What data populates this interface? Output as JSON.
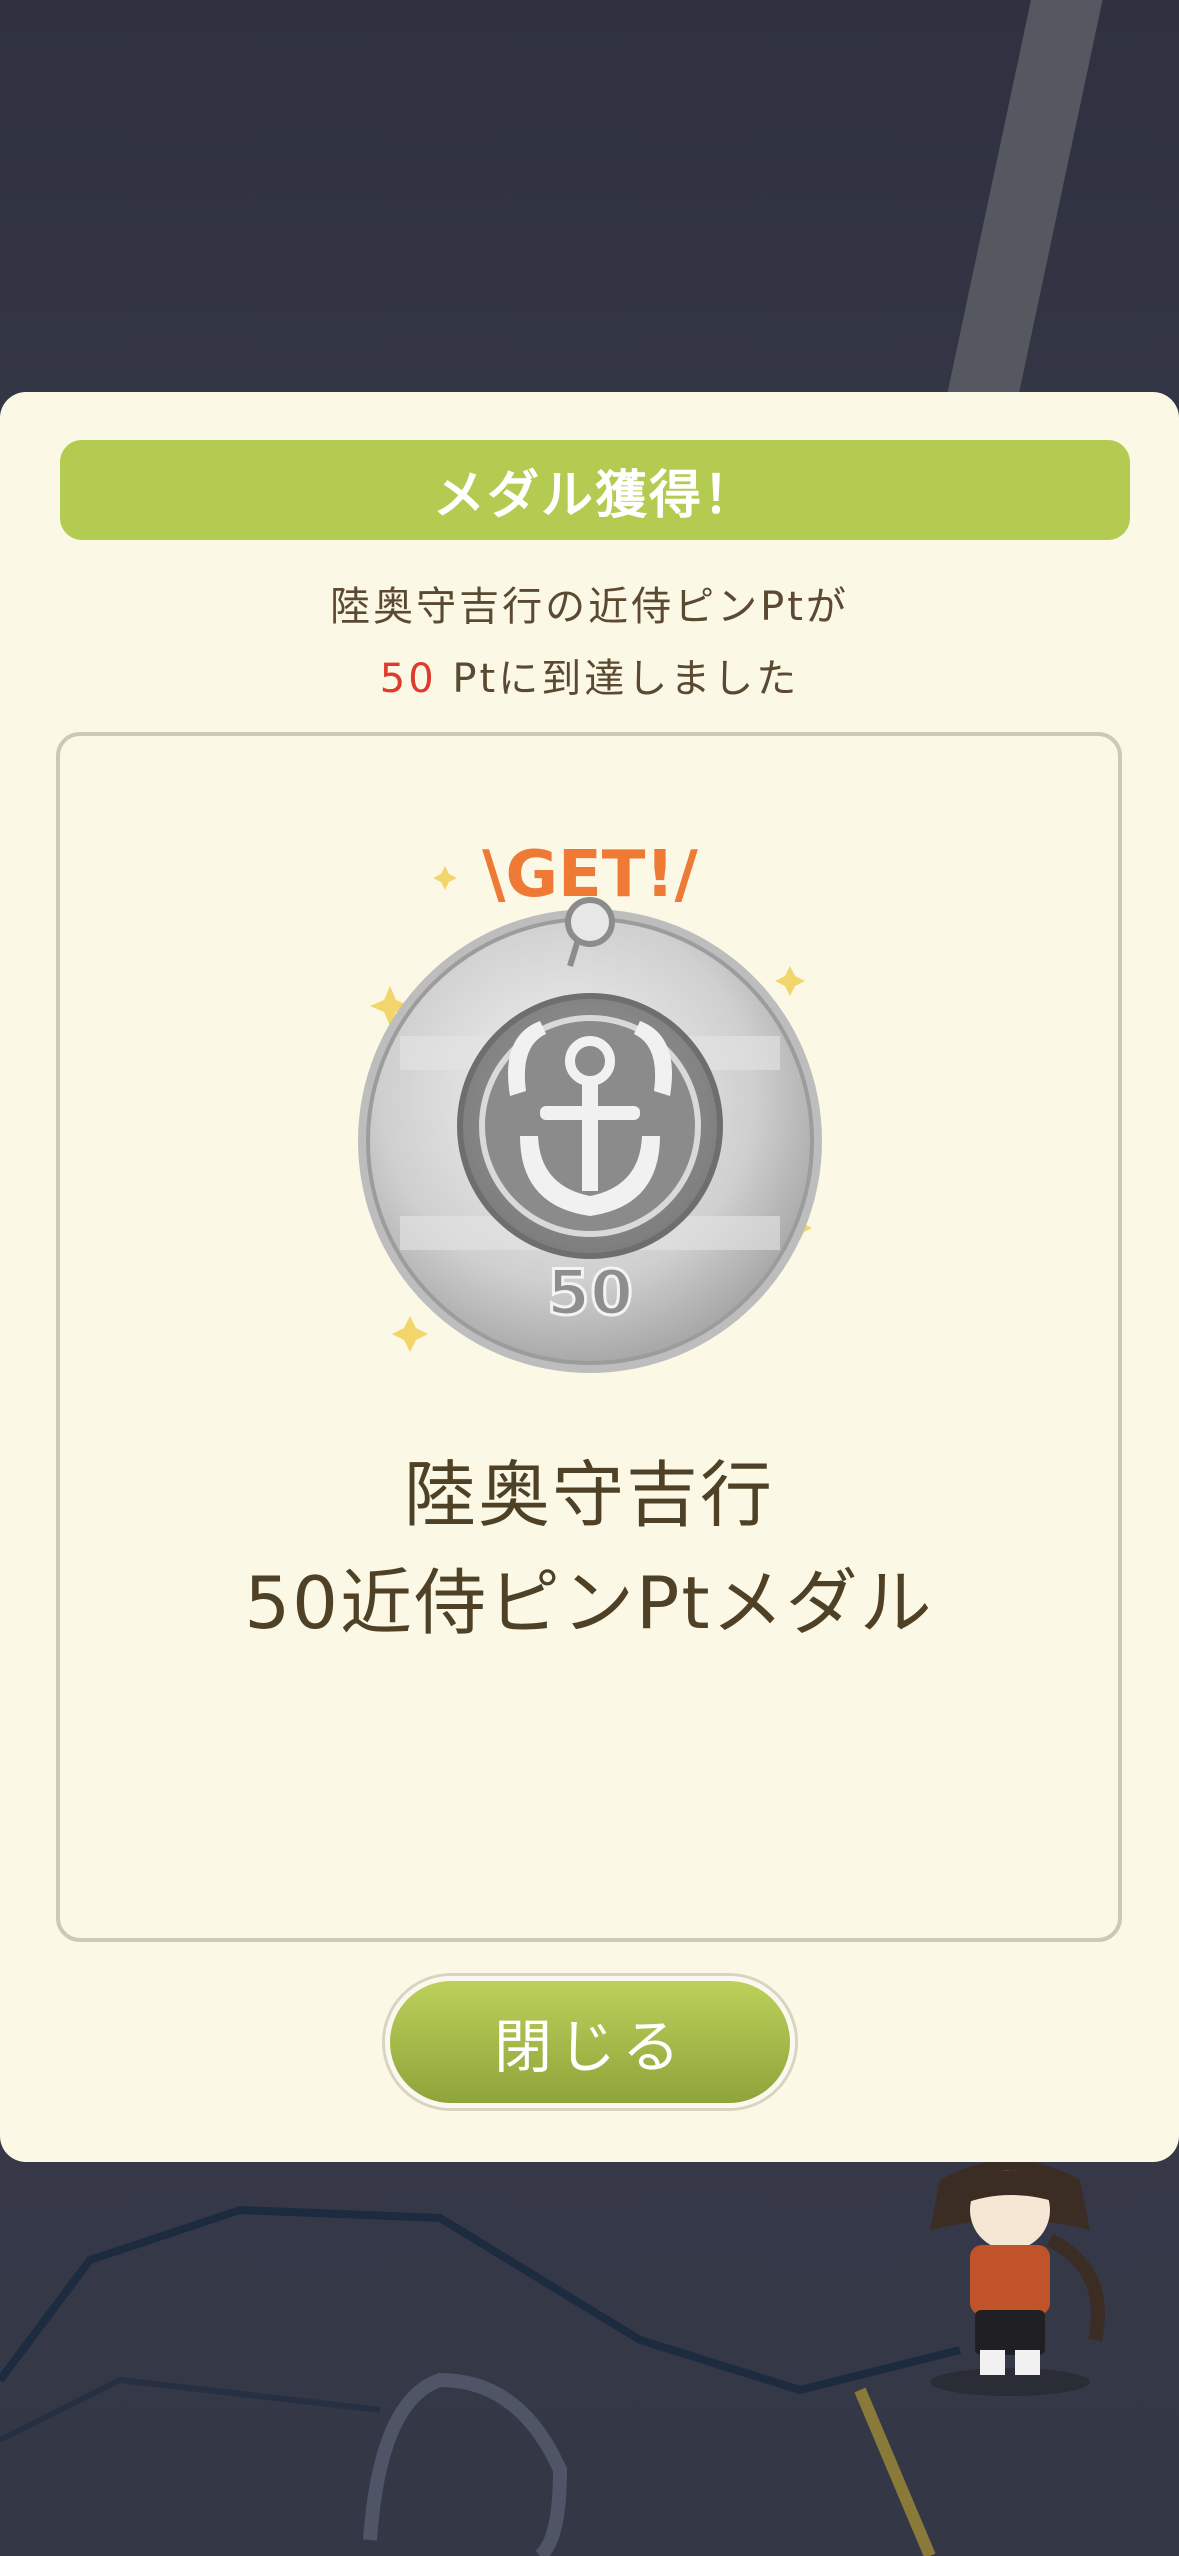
{
  "modal": {
    "title": "メダル獲得！",
    "message_line1": "陸奥守吉行の近侍ピンPtが",
    "message_points": "50",
    "message_line2_rest": " Ptに到達しました",
    "medal": {
      "badge_text": "\\GET!/",
      "coin_number": "50",
      "name_line1": "陸奥守吉行",
      "name_line2": "50近侍ピンPtメダル"
    },
    "close_label": "閉じる"
  },
  "colors": {
    "accent_green": "#b3cb50",
    "points_red": "#e03a2c",
    "text_brown": "#5b4a31",
    "panel_bg": "#fcf8e6"
  }
}
